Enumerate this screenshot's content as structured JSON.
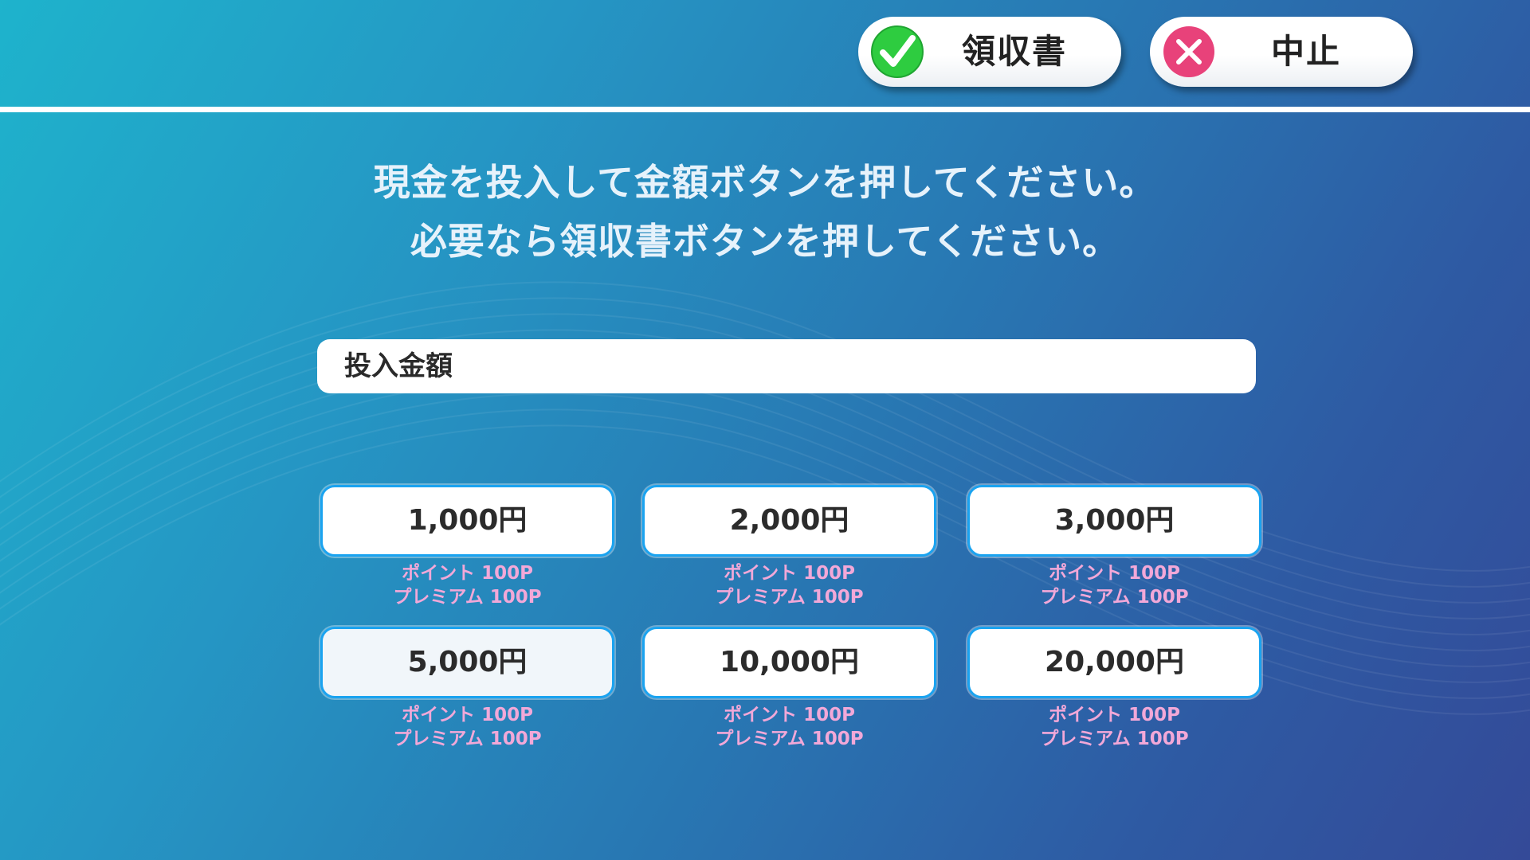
{
  "header": {
    "receipt_button": {
      "label": "領収書",
      "icon": "check-icon",
      "icon_color": "#2ecc40"
    },
    "cancel_button": {
      "label": "中止",
      "icon": "close-icon",
      "icon_color": "#e8427a"
    }
  },
  "instructions": {
    "line1": "現金を投入して金額ボタンを押してください。",
    "line2": "必要なら領収書ボタンを押してください。"
  },
  "amount": {
    "label": "投入金額",
    "value": ""
  },
  "denominations": [
    {
      "amount": "1,000円",
      "point": "ポイント 100P",
      "premium": "プレミアム 100P"
    },
    {
      "amount": "2,000円",
      "point": "ポイント 100P",
      "premium": "プレミアム 100P"
    },
    {
      "amount": "3,000円",
      "point": "ポイント 100P",
      "premium": "プレミアム 100P"
    },
    {
      "amount": "5,000円",
      "point": "ポイント 100P",
      "premium": "プレミアム 100P"
    },
    {
      "amount": "10,000円",
      "point": "ポイント 100P",
      "premium": "プレミアム 100P"
    },
    {
      "amount": "20,000円",
      "point": "ポイント 100P",
      "premium": "プレミアム 100P"
    }
  ],
  "colors": {
    "accent_border": "#1aa3f0",
    "bonus_text": "#f2a8d8",
    "background_start": "#1eb3cc",
    "background_end": "#344a98"
  }
}
